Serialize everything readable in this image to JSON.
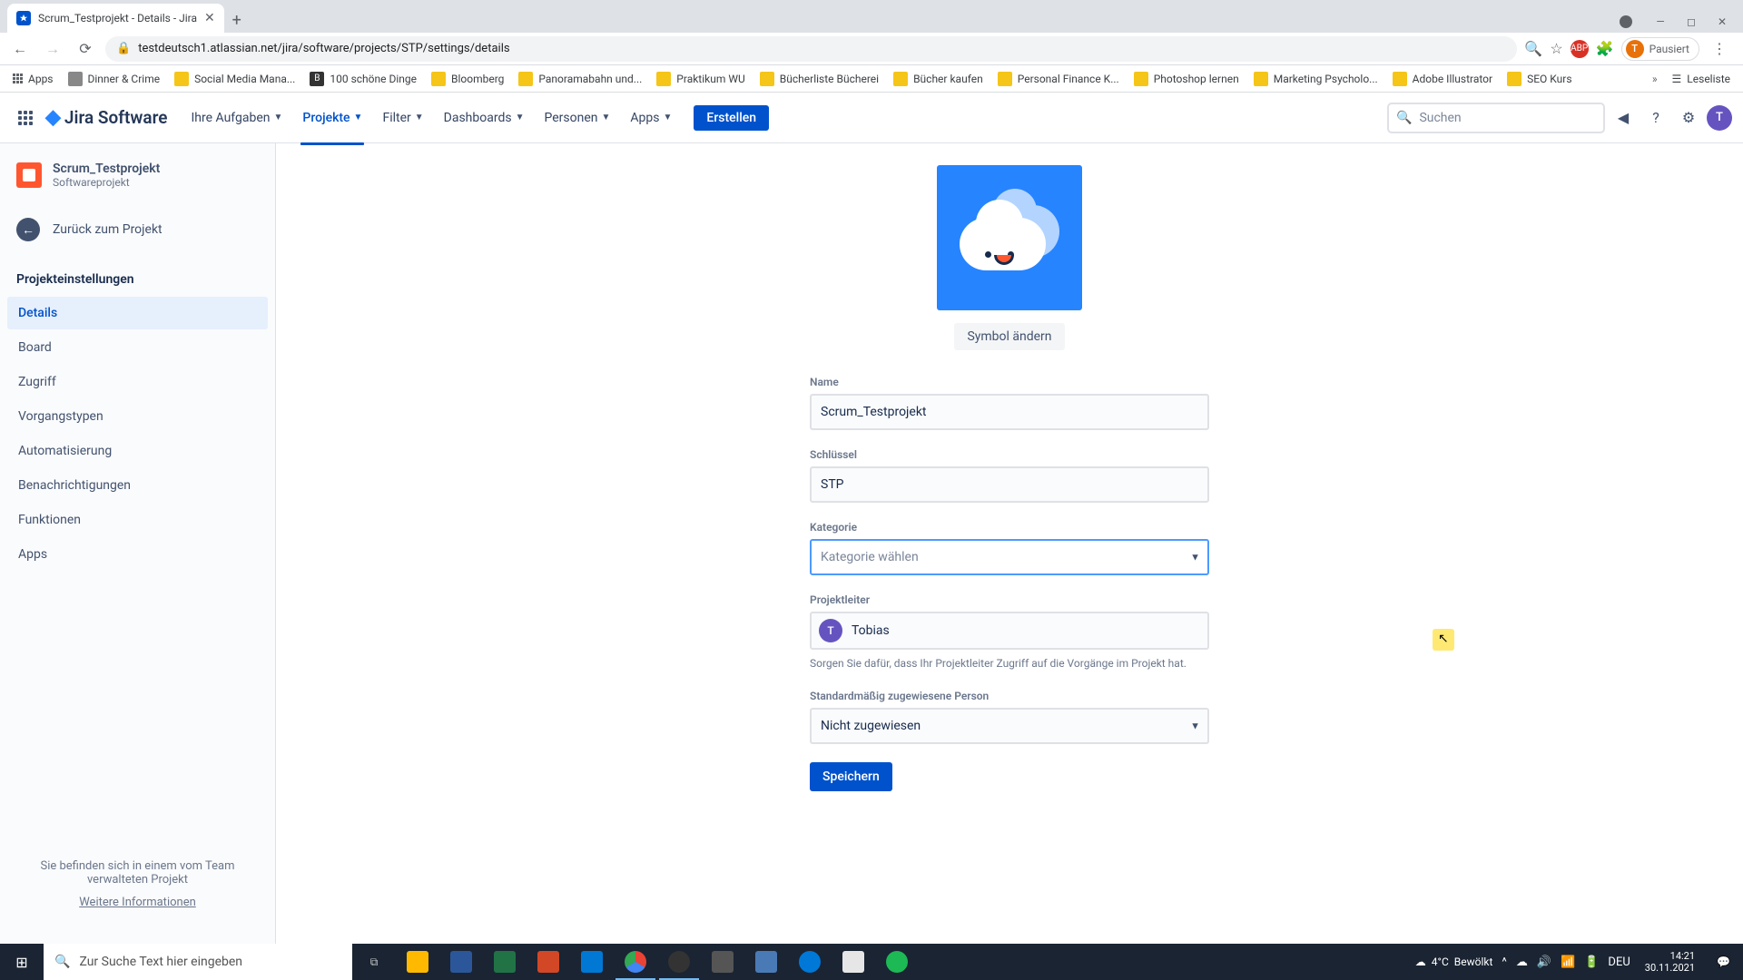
{
  "browser": {
    "tab_title": "Scrum_Testprojekt - Details - Jira",
    "url": "testdeutsch1.atlassian.net/jira/software/projects/STP/settings/details",
    "profile_status": "Pausiert",
    "profile_initial": "T"
  },
  "bookmarks": {
    "apps": "Apps",
    "items": [
      "Dinner & Crime",
      "Social Media Mana...",
      "100 schöne Dinge",
      "Bloomberg",
      "Panoramabahn und...",
      "Praktikum WU",
      "Bücherliste Bücherei",
      "Bücher kaufen",
      "Personal Finance K...",
      "Photoshop lernen",
      "Marketing Psycholo...",
      "Adobe Illustrator",
      "SEO Kurs"
    ],
    "reading_list": "Leseliste"
  },
  "jira_nav": {
    "product": "Jira Software",
    "items": [
      "Ihre Aufgaben",
      "Projekte",
      "Filter",
      "Dashboards",
      "Personen",
      "Apps"
    ],
    "create": "Erstellen",
    "search_placeholder": "Suchen",
    "avatar_initial": "T"
  },
  "sidebar": {
    "project_name": "Scrum_Testprojekt",
    "project_type": "Softwareprojekt",
    "back": "Zurück zum Projekt",
    "section": "Projekteinstellungen",
    "items": [
      "Details",
      "Board",
      "Zugriff",
      "Vorgangstypen",
      "Automatisierung",
      "Benachrichtigungen",
      "Funktionen",
      "Apps"
    ],
    "footer_line": "Sie befinden sich in einem vom Team verwalteten Projekt",
    "footer_link": "Weitere Informationen"
  },
  "form": {
    "change_icon": "Symbol ändern",
    "name_label": "Name",
    "name_value": "Scrum_Testprojekt",
    "key_label": "Schlüssel",
    "key_value": "STP",
    "category_label": "Kategorie",
    "category_placeholder": "Kategorie wählen",
    "lead_label": "Projektleiter",
    "lead_name": "Tobias",
    "lead_initial": "T",
    "lead_help": "Sorgen Sie dafür, dass Ihr Projektleiter Zugriff auf die Vorgänge im Projekt hat.",
    "assignee_label": "Standardmäßig zugewiesene Person",
    "assignee_value": "Nicht zugewiesen",
    "save": "Speichern"
  },
  "taskbar": {
    "search_placeholder": "Zur Suche Text hier eingeben",
    "weather_temp": "4°C",
    "weather_desc": "Bewölkt",
    "lang": "DEU",
    "time": "14:21",
    "date": "30.11.2021"
  }
}
